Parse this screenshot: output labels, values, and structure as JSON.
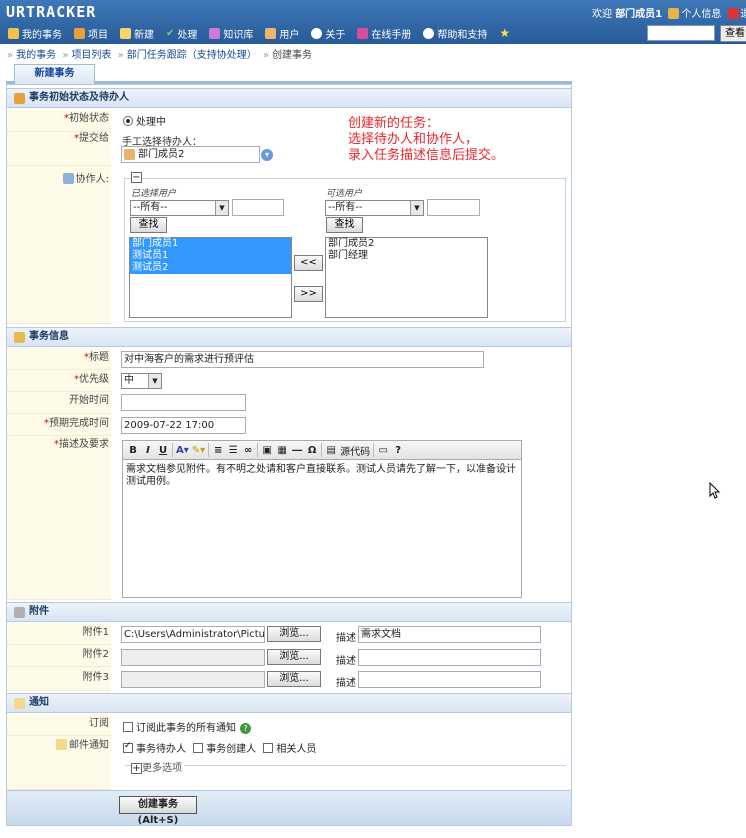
{
  "app": {
    "logo": "URTRACKER"
  },
  "header": {
    "welcome_prefix": "欢迎",
    "user_name": "部门成员1",
    "personal_info": "个人信息",
    "logout": "退",
    "search_placeholder": "",
    "search_button": "查看"
  },
  "menu": [
    {
      "label": "我的事务",
      "icon": "home-icon"
    },
    {
      "label": "项目",
      "icon": "project-icon"
    },
    {
      "label": "新建",
      "icon": "new-icon"
    },
    {
      "label": "处理",
      "icon": "check-icon"
    },
    {
      "label": "知识库",
      "icon": "knowledge-icon"
    },
    {
      "label": "用户",
      "icon": "users-icon"
    },
    {
      "label": "关于",
      "icon": "info-icon"
    },
    {
      "label": "在线手册",
      "icon": "book-icon"
    },
    {
      "label": "帮助和支持",
      "icon": "help-icon"
    }
  ],
  "breadcrumb": [
    "我的事务",
    "项目列表",
    "部门任务跟踪（支持协处理）",
    "创建事务"
  ],
  "tab": {
    "label": "新建事务"
  },
  "sections": {
    "initial": "事务初始状态及待办人",
    "info": "事务信息",
    "attach": "附件",
    "notify": "通知"
  },
  "form": {
    "initial_state_label": "初始状态",
    "initial_state_value": "处理中",
    "submit_to_label": "提交给",
    "submit_to_hint": "手工选择待办人：",
    "submit_to_value": "部门成员2",
    "collab_label": "协作人:",
    "collab_toggle": "−",
    "selected_users_caption": "已选择用户",
    "available_users_caption": "可选用户",
    "filter_all": "--所有--",
    "find_button": "查找",
    "selected_users": [
      "部门成员1",
      "测试员1",
      "测试员2"
    ],
    "available_users": [
      "部门成员2",
      "部门经理"
    ],
    "move_left": "<<",
    "move_right": ">>",
    "title_label": "标题",
    "title_value": "对中海客户的需求进行预评估",
    "priority_label": "优先级",
    "priority_value": "中",
    "start_label": "开始时间",
    "start_value": "",
    "due_label": "预期完成时间",
    "due_value": "2009-07-22 17:00",
    "desc_label": "描述及要求",
    "desc_value": "需求文档参见附件。有不明之处请和客户直接联系。测试人员请先了解一下，以准备设计测试用例。",
    "source_code": "源代码",
    "attachments": [
      {
        "label": "附件1",
        "path": "C:\\Users\\Administrator\\Picture",
        "browse": "浏览...",
        "desc_label": "描述",
        "desc": "需求文档"
      },
      {
        "label": "附件2",
        "path": "",
        "browse": "浏览...",
        "desc_label": "描述",
        "desc": ""
      },
      {
        "label": "附件3",
        "path": "",
        "browse": "浏览...",
        "desc_label": "描述",
        "desc": ""
      }
    ],
    "subscribe_label": "订阅",
    "subscribe_text": "订阅此事务的所有通知",
    "mail_label": "邮件通知",
    "mail_options": [
      {
        "label": "事务待办人",
        "checked": true
      },
      {
        "label": "事务创建人",
        "checked": false
      },
      {
        "label": "相关人员",
        "checked": false
      }
    ],
    "more_options": "更多选项",
    "submit": "创建事务(Alt+S)"
  },
  "annotation": "创建新的任务：\n选择待办人和协作人，\n录入任务描述信息后提交。"
}
